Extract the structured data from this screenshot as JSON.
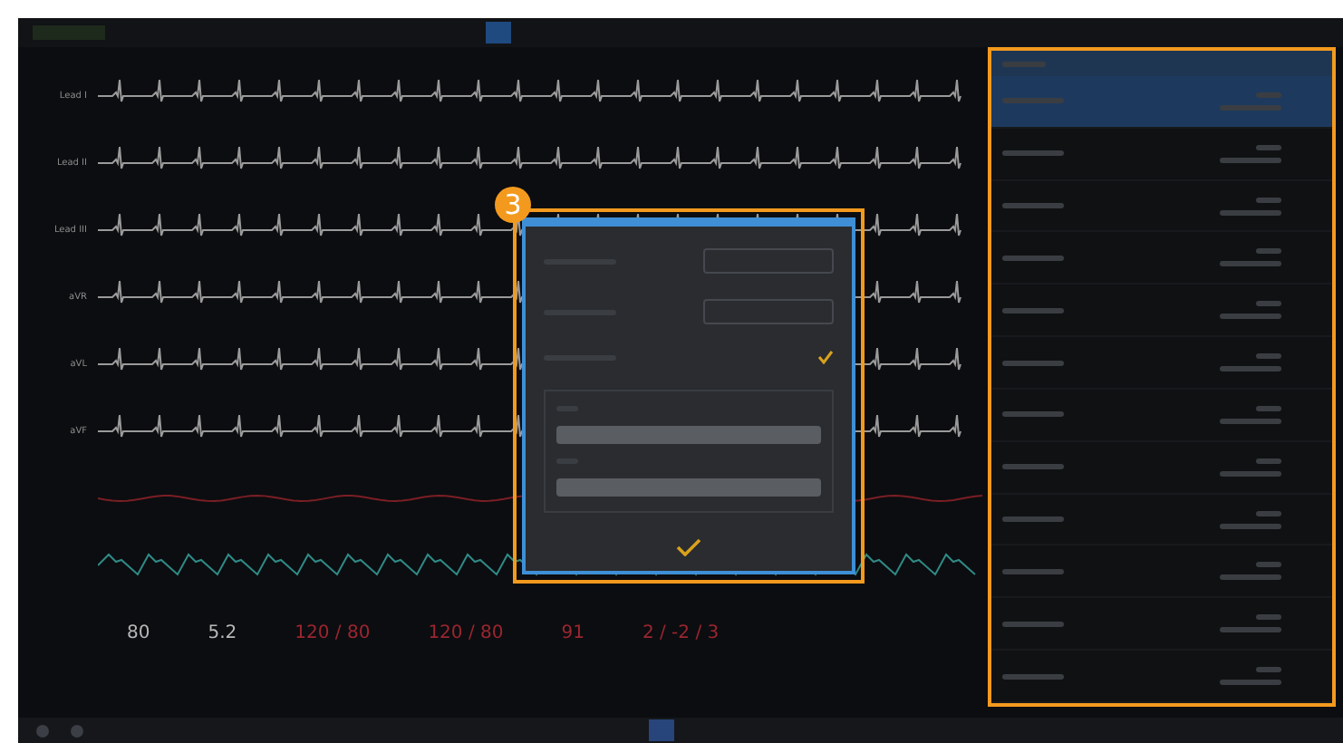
{
  "waves": [
    {
      "label": "Lead I",
      "kind": "ecg"
    },
    {
      "label": "Lead II",
      "kind": "ecg"
    },
    {
      "label": "Lead III",
      "kind": "ecg"
    },
    {
      "label": "aVR",
      "kind": "ecg"
    },
    {
      "label": "aVL",
      "kind": "ecg"
    },
    {
      "label": "aVF",
      "kind": "ecg"
    },
    {
      "kind": "pressure"
    },
    {
      "kind": "pleth"
    }
  ],
  "numerics": [
    {
      "value": "80",
      "alarm": false
    },
    {
      "value": "5.2",
      "alarm": false
    },
    {
      "value": "120 / 80",
      "alarm": true
    },
    {
      "value": "120 / 80",
      "alarm": true
    },
    {
      "value": "91",
      "alarm": true
    },
    {
      "value": "2 / -2 / 3",
      "alarm": true
    }
  ],
  "dialog": {
    "badge": "3",
    "rows": [
      {
        "kind": "select"
      },
      {
        "kind": "select"
      },
      {
        "kind": "check",
        "checked": true
      }
    ],
    "fields": [
      {
        "kind": "input"
      },
      {
        "kind": "input"
      }
    ]
  },
  "panel": {
    "rows": [
      {
        "selected": true
      },
      {
        "selected": false
      },
      {
        "selected": false
      },
      {
        "selected": false
      },
      {
        "selected": false
      },
      {
        "selected": false
      },
      {
        "selected": false
      },
      {
        "selected": false
      },
      {
        "selected": false
      },
      {
        "selected": false
      },
      {
        "selected": false
      },
      {
        "selected": false
      }
    ]
  }
}
